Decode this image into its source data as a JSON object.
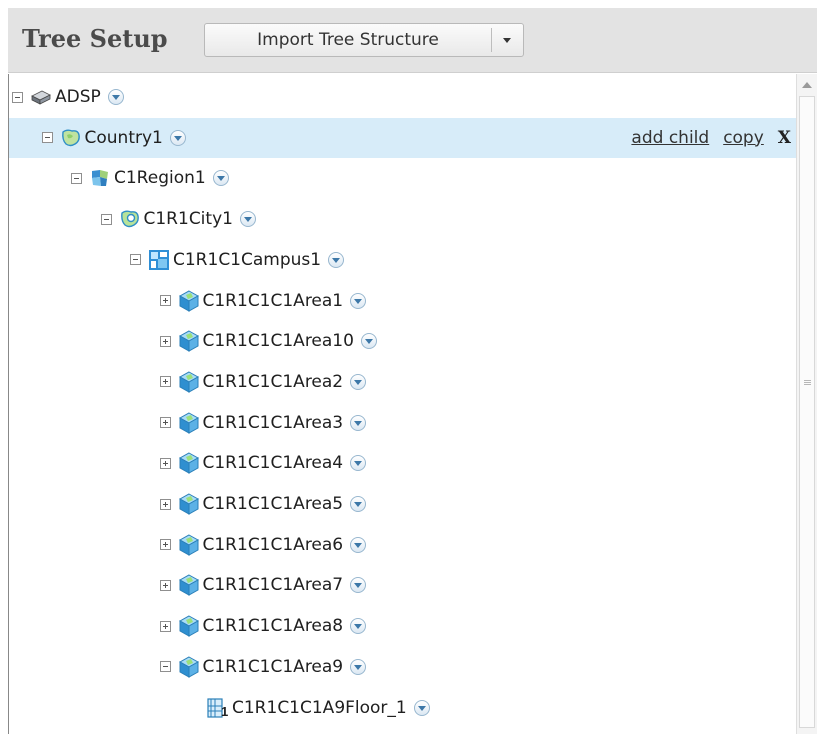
{
  "header": {
    "title": "Tree Setup",
    "import_button_label": "Import Tree Structure",
    "import_dropdown_icon": "caret-down-icon"
  },
  "colors": {
    "header_bg": "#e3e3e3",
    "selected_row_bg": "#d7ecf9",
    "tree_border": "#888888"
  },
  "tree": {
    "nodes": [
      {
        "label": "ADSP",
        "icon": "server-icon",
        "expanded": true,
        "depth": 0
      },
      {
        "label": "Country1",
        "icon": "country-icon",
        "expanded": true,
        "depth": 1,
        "selected": true
      },
      {
        "label": "C1Region1",
        "icon": "region-icon",
        "expanded": true,
        "depth": 2
      },
      {
        "label": "C1R1City1",
        "icon": "city-icon",
        "expanded": true,
        "depth": 3
      },
      {
        "label": "C1R1C1Campus1",
        "icon": "campus-icon",
        "expanded": true,
        "depth": 4
      },
      {
        "label": "C1R1C1C1Area1",
        "icon": "area-icon",
        "expanded": false,
        "depth": 5
      },
      {
        "label": "C1R1C1C1Area10",
        "icon": "area-icon",
        "expanded": false,
        "depth": 5
      },
      {
        "label": "C1R1C1C1Area2",
        "icon": "area-icon",
        "expanded": false,
        "depth": 5
      },
      {
        "label": "C1R1C1C1Area3",
        "icon": "area-icon",
        "expanded": false,
        "depth": 5
      },
      {
        "label": "C1R1C1C1Area4",
        "icon": "area-icon",
        "expanded": false,
        "depth": 5
      },
      {
        "label": "C1R1C1C1Area5",
        "icon": "area-icon",
        "expanded": false,
        "depth": 5
      },
      {
        "label": "C1R1C1C1Area6",
        "icon": "area-icon",
        "expanded": false,
        "depth": 5
      },
      {
        "label": "C1R1C1C1Area7",
        "icon": "area-icon",
        "expanded": false,
        "depth": 5
      },
      {
        "label": "C1R1C1C1Area8",
        "icon": "area-icon",
        "expanded": false,
        "depth": 5
      },
      {
        "label": "C1R1C1C1Area9",
        "icon": "area-icon",
        "expanded": true,
        "depth": 5
      },
      {
        "label": "C1R1C1C1A9Floor_1",
        "icon": "floor-icon",
        "expanded": null,
        "depth": 6
      }
    ],
    "selected_actions": {
      "add_child": "add child",
      "copy": "copy",
      "delete": "X"
    }
  }
}
